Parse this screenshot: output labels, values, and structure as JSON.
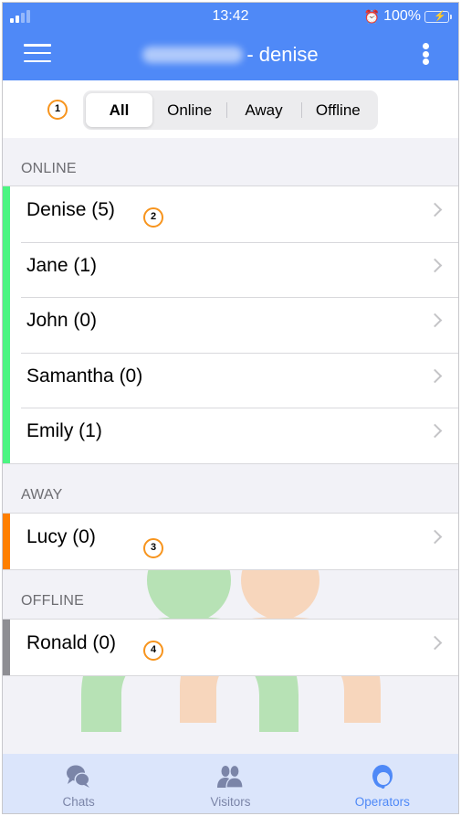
{
  "status_bar": {
    "time": "13:42",
    "battery_percent": "100%",
    "signal_bars_active": 2,
    "signal_bars_total": 4,
    "alarm_icon": "alarm-clock-icon",
    "battery_charging": true
  },
  "header": {
    "title_suffix": "- denise",
    "title_prefix_obscured": true,
    "menu_icon": "hamburger-icon",
    "more_icon": "more-vertical-icon"
  },
  "filter": {
    "tabs": [
      {
        "label": "All",
        "active": true
      },
      {
        "label": "Online",
        "active": false
      },
      {
        "label": "Away",
        "active": false
      },
      {
        "label": "Offline",
        "active": false
      }
    ]
  },
  "annotations": [
    "1",
    "2",
    "3",
    "4"
  ],
  "sections": [
    {
      "label": "ONLINE",
      "color": "#4cf582",
      "operators": [
        {
          "name": "Denise (5)"
        },
        {
          "name": "Jane (1)"
        },
        {
          "name": "John (0)"
        },
        {
          "name": "Samantha (0)"
        },
        {
          "name": "Emily (1)"
        }
      ]
    },
    {
      "label": "AWAY",
      "color": "#ff7f00",
      "operators": [
        {
          "name": "Lucy (0)"
        }
      ]
    },
    {
      "label": "OFFLINE",
      "color": "#8e8e93",
      "operators": [
        {
          "name": "Ronald (0)"
        }
      ]
    }
  ],
  "tabbar": {
    "items": [
      {
        "label": "Chats",
        "icon": "chat-bubbles-icon",
        "active": false
      },
      {
        "label": "Visitors",
        "icon": "visitors-icon",
        "active": false
      },
      {
        "label": "Operators",
        "icon": "operator-headset-icon",
        "active": true
      }
    ]
  },
  "colors": {
    "header": "#4f89f7",
    "accent": "#4f89f7",
    "badge": "#f7941d",
    "tabbar": "#dbe5fb"
  }
}
